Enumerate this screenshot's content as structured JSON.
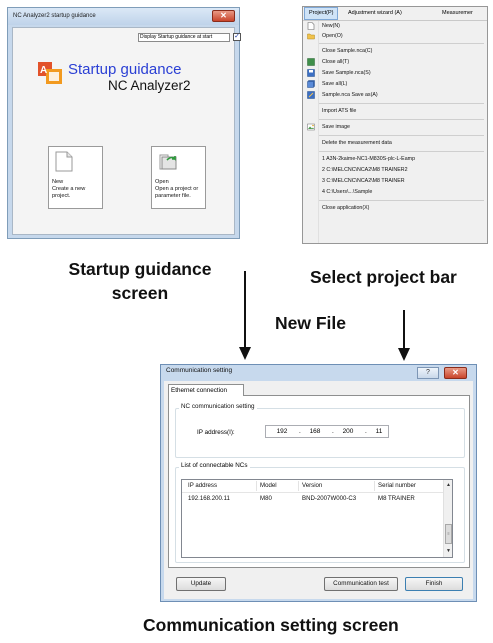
{
  "startup_window": {
    "title": "NC Analyzer2 startup guidance",
    "display_guidance_label": "Display Startup guidance at start",
    "display_guidance_checked": true,
    "heading": "Startup guidance",
    "app_name": "NC Analyzer2",
    "tiles": [
      {
        "label": "New",
        "description": "Create a new project.",
        "icon": "blank-document-icon"
      },
      {
        "label": "Open",
        "description": "Open a project or parameter file.",
        "icon": "open-folder-icon"
      }
    ]
  },
  "project_menu": {
    "menubar": [
      "Project(P)",
      "Adjustment wizard (A)",
      "Measuremer"
    ],
    "items": [
      {
        "label": "New(N)",
        "icon": "new-file-icon"
      },
      {
        "label": "Open(O)",
        "icon": "open-folder-icon"
      },
      {
        "label": "Close Sample.nca(C)",
        "icon": ""
      },
      {
        "label": "Close all(T)",
        "icon": "close-all-icon"
      },
      {
        "label": "Save Sample.nca(S)",
        "icon": "save-icon"
      },
      {
        "label": "Save all(L)",
        "icon": "save-all-icon"
      },
      {
        "label": "Sample.nca Save as(A)",
        "icon": "save-as-icon"
      },
      {
        "label": "Import ATS file",
        "icon": ""
      },
      {
        "label": "Save image",
        "icon": "save-image-icon"
      },
      {
        "label": "Delete the measurement data",
        "icon": ""
      },
      {
        "label": "1 A3N-2kaime-NC1-M830S-plc-L-Eamp",
        "icon": ""
      },
      {
        "label": "2 C:\\MELCNC\\NCA2\\M8 TRAINER2",
        "icon": ""
      },
      {
        "label": "3 C:\\MELCNC\\NCA2\\M8 TRAINER",
        "icon": ""
      },
      {
        "label": "4 C:\\Users\\...\\Sample",
        "icon": ""
      },
      {
        "label": "Close application(X)",
        "icon": ""
      }
    ]
  },
  "captions": {
    "startup": "Startup guidance screen",
    "select": "Select project bar",
    "new_file": "New File",
    "comm": "Communication setting screen"
  },
  "comm_window": {
    "title": "Communication setting",
    "help": "?",
    "tab": "Ethernet connection",
    "nc_group_label": "NC communication setting",
    "ip_label": "IP address(I):",
    "ip": [
      "192",
      "168",
      "200",
      "11"
    ],
    "list_label": "List of connectable NCs",
    "columns": [
      "IP address",
      "Model",
      "Version",
      "Serial number"
    ],
    "rows": [
      [
        "192.168.200.11",
        "M80",
        "BND-2007W000-C3",
        "M8 TRAINER"
      ]
    ],
    "buttons": {
      "update": "Update",
      "comm_test": "Communication test",
      "finish": "Finish"
    }
  },
  "colors": {
    "accent": "#2a3fd4",
    "close_red": "#c9452c",
    "window_frame": "#c7d9ed"
  }
}
